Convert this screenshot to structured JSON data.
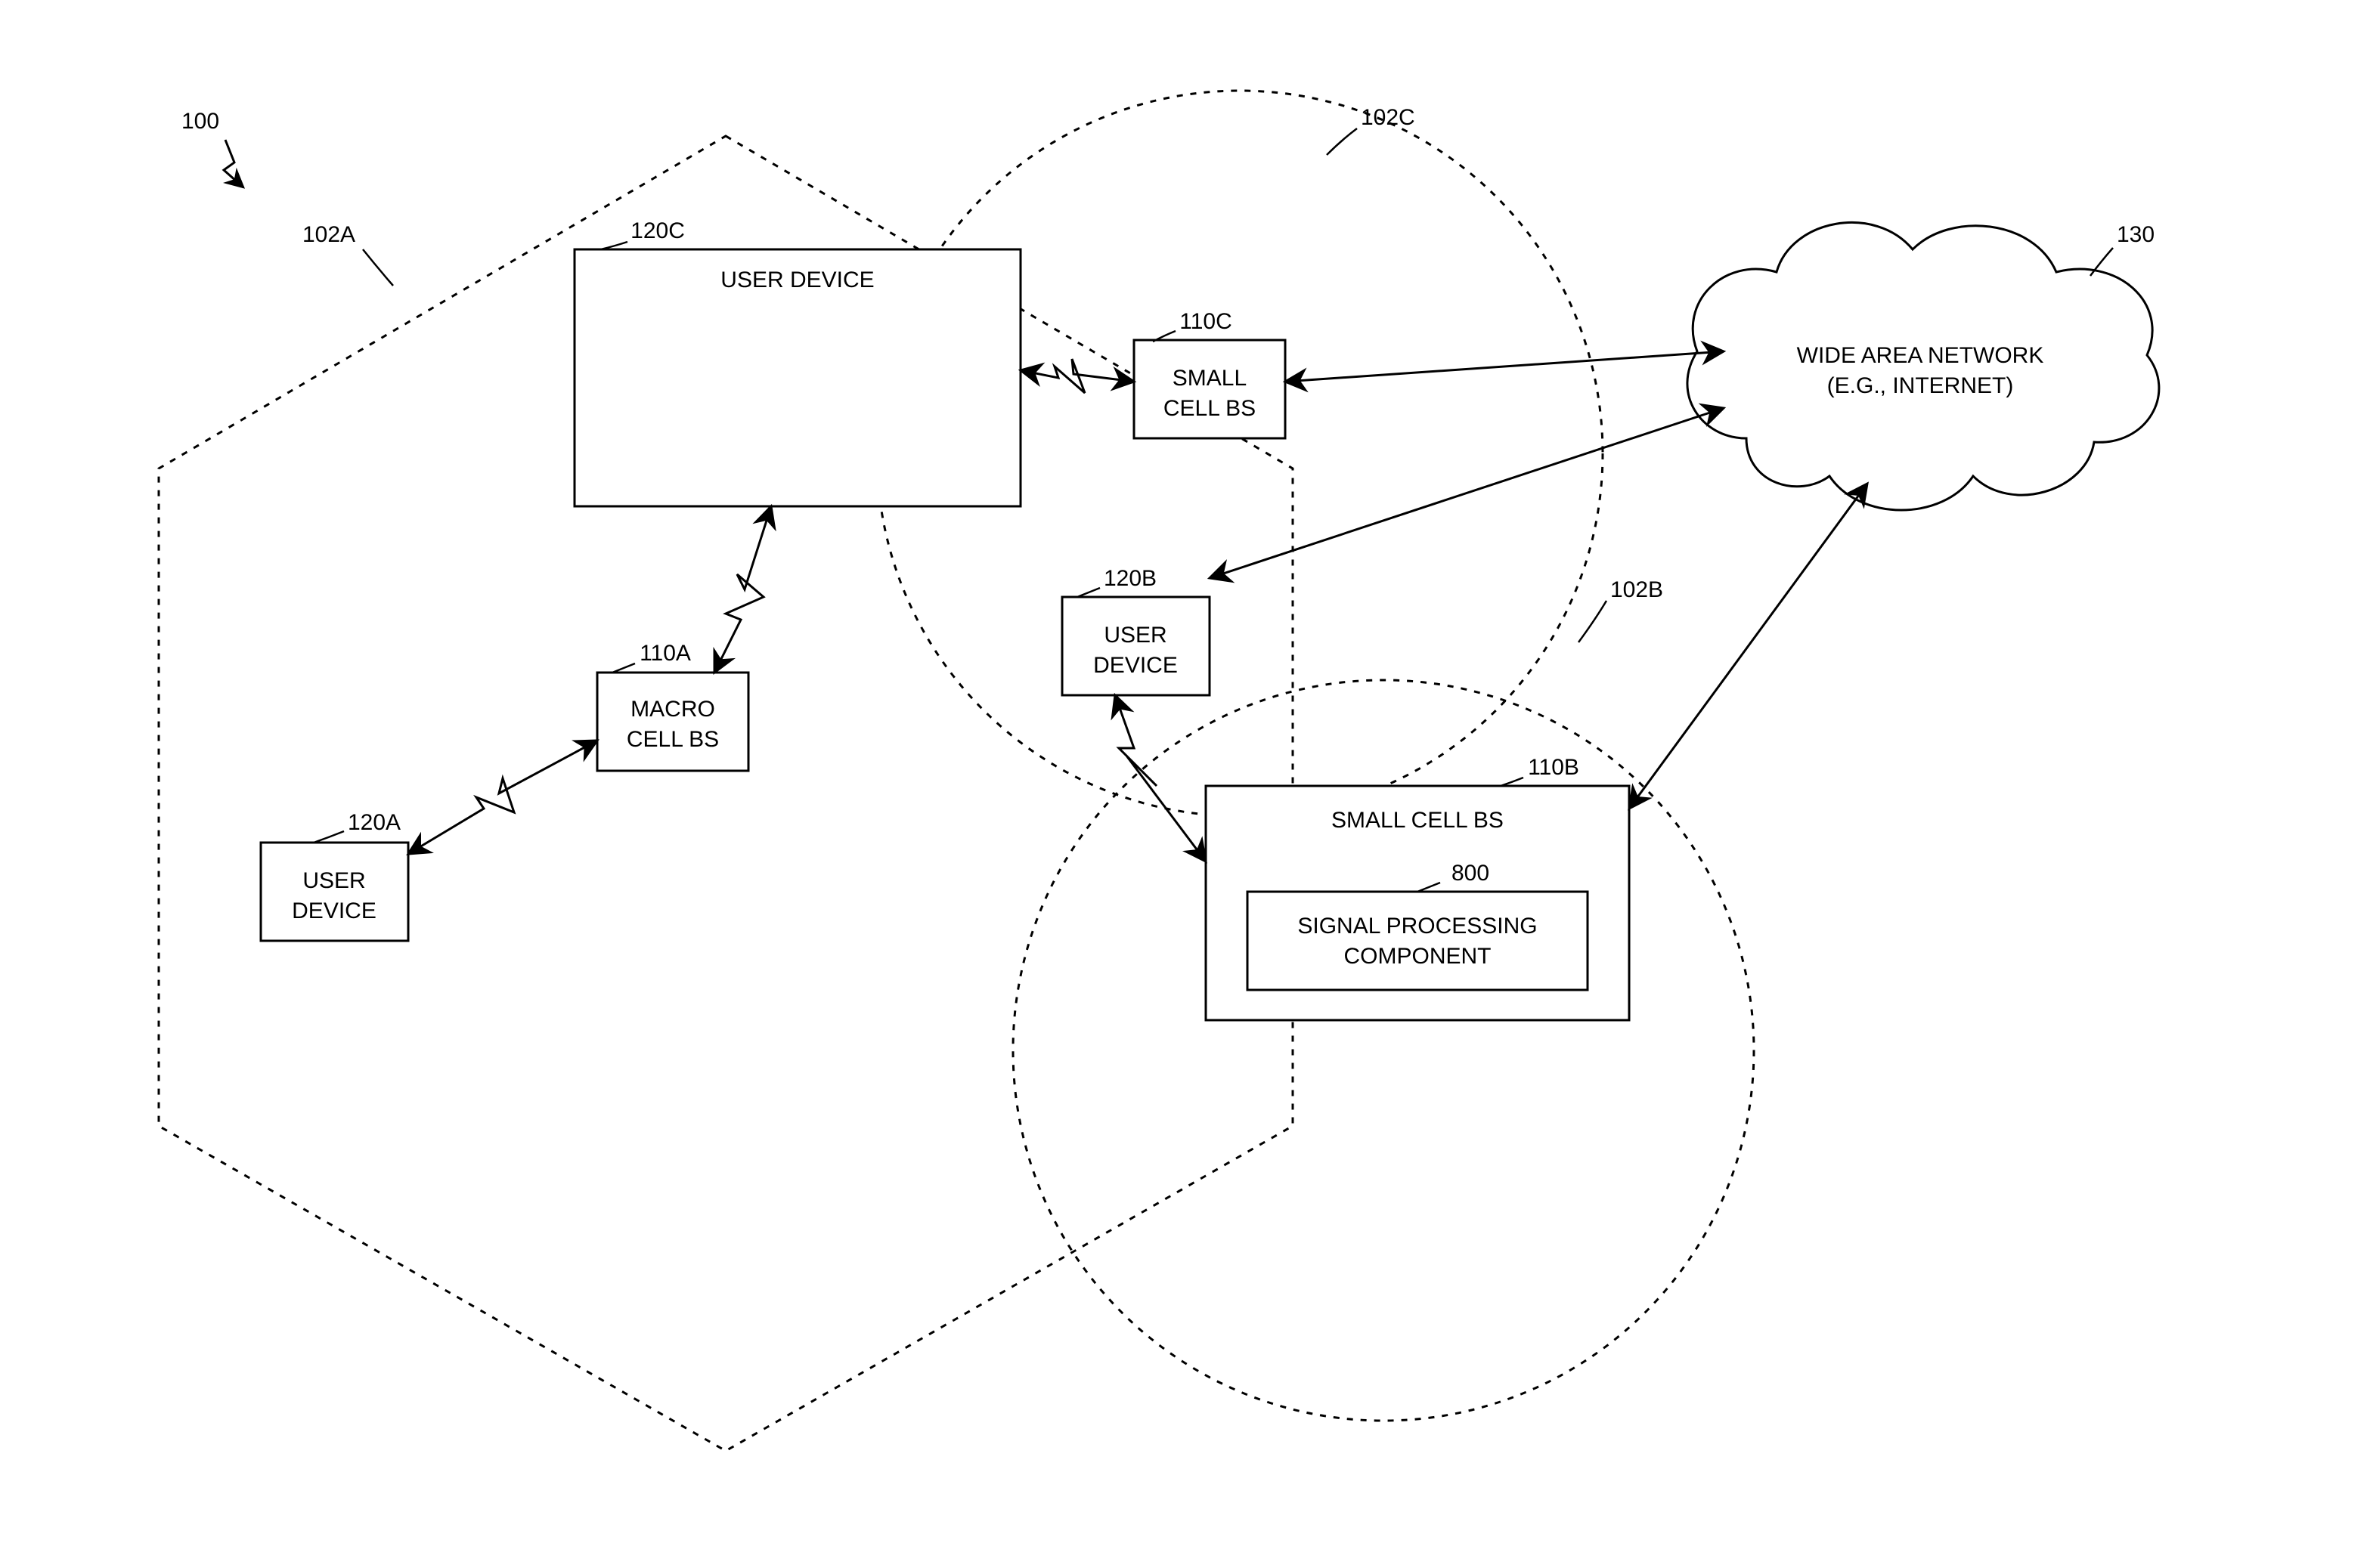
{
  "figure_ref": "100",
  "regions": {
    "hexagon": {
      "ref": "102A"
    },
    "circle_top": {
      "ref": "102C"
    },
    "circle_bottom": {
      "ref": "102B"
    }
  },
  "nodes": {
    "user_device_a": {
      "ref": "120A",
      "label": [
        "USER",
        "DEVICE"
      ]
    },
    "user_device_b": {
      "ref": "120B",
      "label": [
        "USER",
        "DEVICE"
      ]
    },
    "user_device_c": {
      "ref": "120C",
      "label": [
        "USER DEVICE"
      ]
    },
    "macro_bs": {
      "ref": "110A",
      "label": [
        "MACRO",
        "CELL BS"
      ]
    },
    "small_bs_c": {
      "ref": "110C",
      "label": [
        "SMALL",
        "CELL BS"
      ]
    },
    "small_bs_b": {
      "ref": "110B",
      "label": [
        "SMALL CELL BS"
      ]
    },
    "sig_proc": {
      "ref": "800",
      "label": [
        "SIGNAL PROCESSING",
        "COMPONENT"
      ]
    },
    "wan": {
      "ref": "130",
      "label": [
        "WIDE AREA NETWORK",
        "(E.G., INTERNET)"
      ]
    }
  }
}
